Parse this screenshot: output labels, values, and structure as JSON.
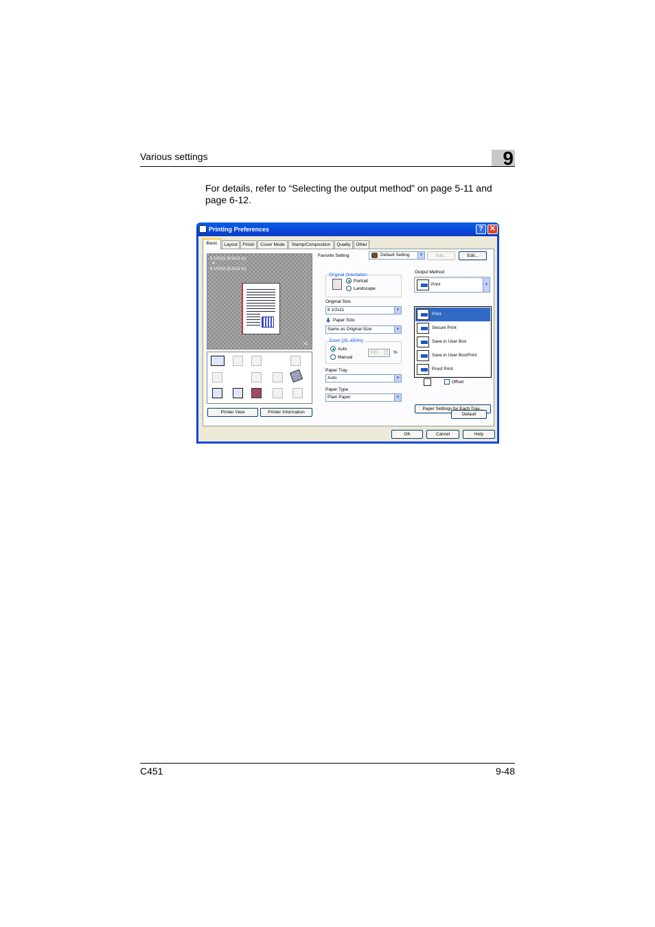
{
  "page": {
    "section_title": "Various settings",
    "chapter_number": "9",
    "intro": "For details, refer to “Selecting the output method” on page 5-11 and page 6-12.",
    "footer_left": "C451",
    "footer_right": "9-48"
  },
  "dialog": {
    "title": "Printing Preferences",
    "help_glyph": "?",
    "close_glyph": "✕",
    "tabs": [
      "Basic",
      "Layout",
      "Finish",
      "Cover Mode",
      "Stamp/Composition",
      "Quality",
      "Other"
    ],
    "active_tab": "Basic",
    "preview": {
      "original_label": "8 1/2x11 (8.5x11 in)",
      "arrow": "▼",
      "paper_label": "8 1/2x11 (8.5x11 in)",
      "copies": "x1"
    },
    "icons": [
      "print-icon",
      "blank-icon",
      "collate-icon",
      "offset-icon",
      "duplex-icon",
      "combine-icon",
      "booklet-icon",
      "staple-icon",
      "user-box-icon",
      "account-icon",
      "authentication-icon",
      "proof-icon",
      "cover-icon"
    ],
    "printer_view_button": "Printer View",
    "printer_information_button": "Printer Information",
    "favorite_setting": {
      "label": "Favorite Setting",
      "value": "Default Setting",
      "add_button": "Add...",
      "edit_button": "Edit..."
    },
    "original_orientation": {
      "label": "Original Orientation",
      "options": [
        "Portrait",
        "Landscape"
      ],
      "selected": "Portrait"
    },
    "original_size": {
      "label": "Original Size",
      "value": "8 1/2x11"
    },
    "paper_size": {
      "label": "Paper Size",
      "value": "Same as Original Size"
    },
    "zoom": {
      "label": "Zoom [25..400%]",
      "options": [
        "Auto",
        "Manual"
      ],
      "selected": "Auto",
      "value": "100",
      "unit": "%"
    },
    "paper_tray": {
      "label": "Paper Tray",
      "value": "Auto"
    },
    "paper_type": {
      "label": "Paper Type",
      "value": "Plain Paper"
    },
    "output_method": {
      "label": "Output Method",
      "value": "Print",
      "options": [
        "Print",
        "Secure Print",
        "Save in User Box",
        "Save in User Box/Print",
        "Proof Print"
      ],
      "highlighted": "Print"
    },
    "offset_label": "Offset",
    "paper_settings_button": "Paper Settings for Each Tray...",
    "default_button": "Default",
    "ok_button": "OK",
    "cancel_button": "Cancel",
    "help_button": "Help",
    "colors": {
      "titlebar": "#0a46d8",
      "selection": "#316ac5",
      "face": "#ece9d8",
      "tab_highlight": "#ffc83c"
    }
  }
}
